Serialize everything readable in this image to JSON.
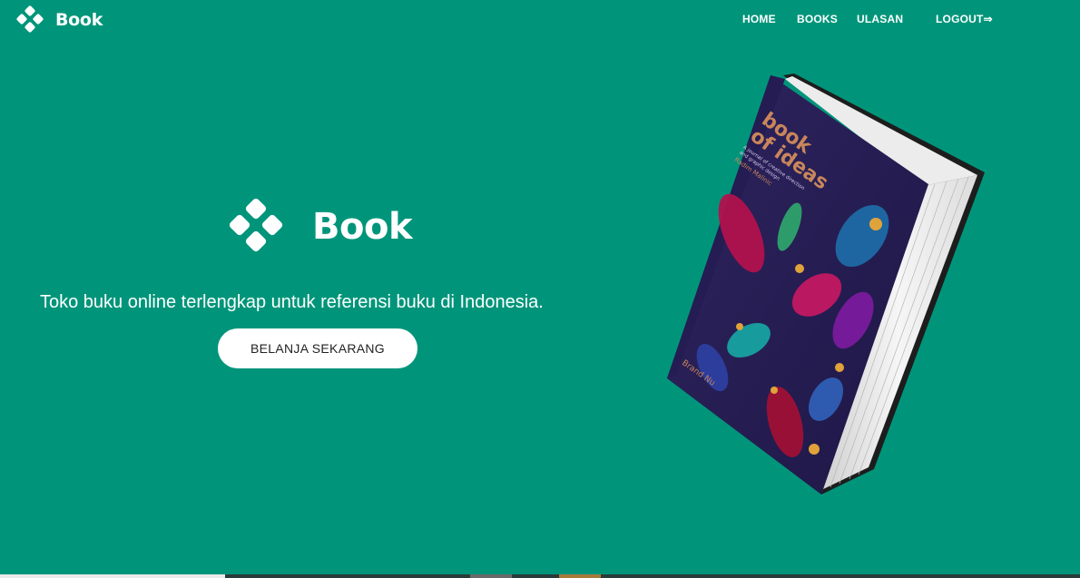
{
  "nav": {
    "brand": "Book",
    "links": [
      "HOME",
      "BOOKS",
      "ULASAN"
    ],
    "logout": "LOGOUT⇒"
  },
  "hero": {
    "logo_text": "Book",
    "tagline": "Toko buku online terlengkap untuk referensi buku di Indonesia.",
    "cta_label": "BELANJA SEKARANG"
  },
  "book_cover": {
    "title_line1": "book",
    "title_line2": "of ideas",
    "subtitle1": "A journal of creative direction",
    "subtitle2": "and graphic design",
    "author": "Radim Malinic",
    "publisher": "Brand Nu"
  },
  "colors": {
    "background": "#00957a",
    "cover": "#2a1f55",
    "button_bg": "#ffffff"
  },
  "icons": {
    "brand": "diamond-cluster-logo-icon",
    "logout": "arrow-right-icon"
  }
}
